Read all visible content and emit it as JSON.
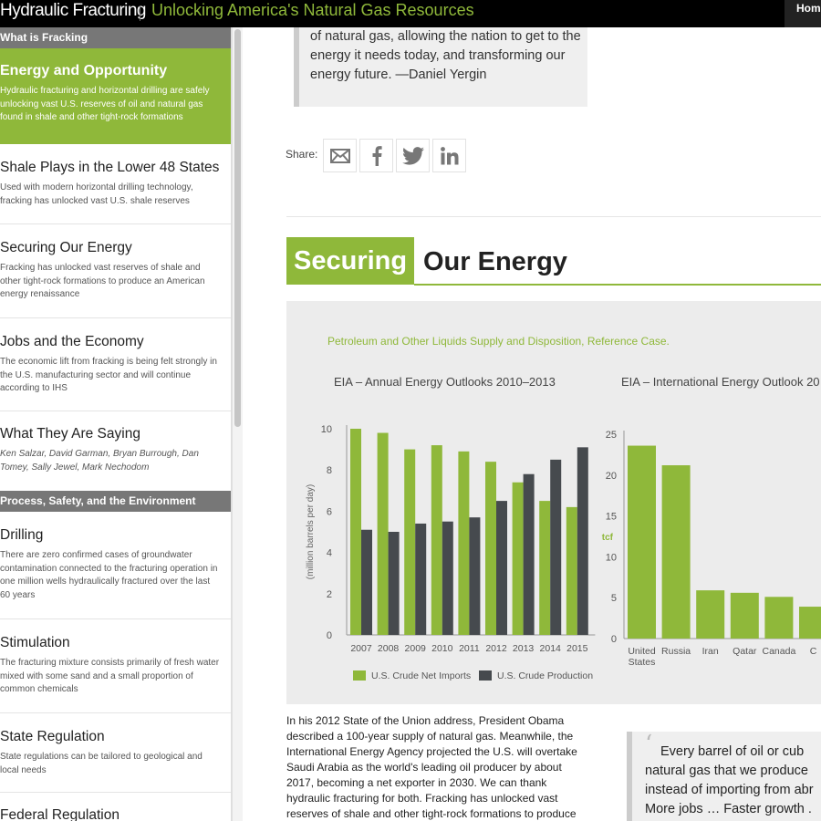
{
  "header": {
    "brand": "Hydraulic Fracturing",
    "tagline": "Unlocking America's Natural Gas Resources",
    "nav_home": "Home"
  },
  "sidebar": {
    "section1": "What is Fracking",
    "items1": [
      {
        "title": "Energy and Opportunity",
        "desc": "Hydraulic fracturing and horizontal drilling are safely unlocking vast U.S. reserves of oil and natural gas found in shale and other tight-rock formations"
      },
      {
        "title": "Shale Plays in the Lower 48 States",
        "desc": "Used with modern horizontal drilling technology, fracking has unlocked vast U.S. shale reserves"
      },
      {
        "title": "Securing Our Energy",
        "desc": "Fracking has unlocked vast reserves of shale and other tight-rock formations to produce an American energy renaissance"
      },
      {
        "title": "Jobs and the Economy",
        "desc": "The economic lift from fracking is being felt strongly in the U.S. manufacturing sector and will continue according to IHS"
      },
      {
        "title": "What They Are Saying",
        "desc": "Ken Salzar, David Garman, Bryan Burrough, Dan Tomey, Sally Jewel, Mark Nechodom"
      }
    ],
    "section2": "Process, Safety, and the Environment",
    "items2": [
      {
        "title": "Drilling",
        "desc": "There are zero confirmed cases of groundwater contamination connected to the fracturing operation in one million wells hydraulically fractured over the last 60 years"
      },
      {
        "title": "Stimulation",
        "desc": "The fracturing mixture consists primarily of fresh water mixed with some sand and a small proportion of common chemicals"
      },
      {
        "title": "State Regulation",
        "desc": "State regulations can be tailored to geological and local needs"
      },
      {
        "title": "Federal Regulation",
        "desc": ""
      }
    ]
  },
  "main": {
    "quote_top": "of natural gas, allowing the nation to get to the energy it needs today, and transforming our energy future. —Daniel Yergin",
    "share_label": "Share:",
    "heading_highlight": "Securing",
    "heading_rest": "Our Energy",
    "chart_subtitle": "Petroleum and Other Liquids Supply and Disposition, Reference Case.",
    "body_text": "In his 2012 State of the Union address, President Obama described a 100-year supply of natural gas. Meanwhile, the International Energy Agency projected the U.S. will overtake Saudi Arabia as the world's leading oil producer by about 2017, becoming a net exporter in 2030. We can thank hydraulic fracturing for both. Fracking has unlocked vast reserves of shale and other tight-rock formations to produce",
    "quote_right": "Every barrel of oil or cub natural gas that we produce instead of importing from abr More jobs … Faster growth ."
  },
  "colors": {
    "accent": "#8fb83a",
    "dark_bar": "#464a4e",
    "section": "#777777"
  },
  "icons": {
    "share": [
      "email-icon",
      "facebook-icon",
      "twitter-icon",
      "linkedin-icon"
    ]
  },
  "chart_data": [
    {
      "type": "bar",
      "title": "EIA – Annual Energy Outlooks 2010–2013",
      "ylabel": "(million barrels per day)",
      "ylim": [
        0,
        10
      ],
      "yticks": [
        0,
        2,
        4,
        6,
        8,
        10
      ],
      "categories": [
        "2007",
        "2008",
        "2009",
        "2010",
        "2011",
        "2012",
        "2013",
        "2014",
        "2015"
      ],
      "series": [
        {
          "name": "U.S. Crude Net Imports",
          "color": "#8fb83a",
          "values": [
            10.0,
            9.8,
            9.0,
            9.2,
            8.9,
            8.4,
            7.4,
            6.5,
            6.2
          ]
        },
        {
          "name": "U.S. Crude Production",
          "color": "#464a4e",
          "values": [
            5.1,
            5.0,
            5.4,
            5.5,
            5.7,
            6.5,
            7.8,
            8.5,
            9.1
          ]
        }
      ],
      "legend": "bottom"
    },
    {
      "type": "bar",
      "title": "EIA – International Energy Outlook 20",
      "ylabel": "tcf",
      "ylim": [
        0,
        25
      ],
      "yticks": [
        0,
        5,
        10,
        15,
        20,
        25
      ],
      "categories": [
        "United States",
        "Russia",
        "Iran",
        "Qatar",
        "Canada",
        "C"
      ],
      "values": [
        23.6,
        21.2,
        5.9,
        5.6,
        5.1,
        3.9
      ],
      "color": "#8fb83a"
    }
  ]
}
